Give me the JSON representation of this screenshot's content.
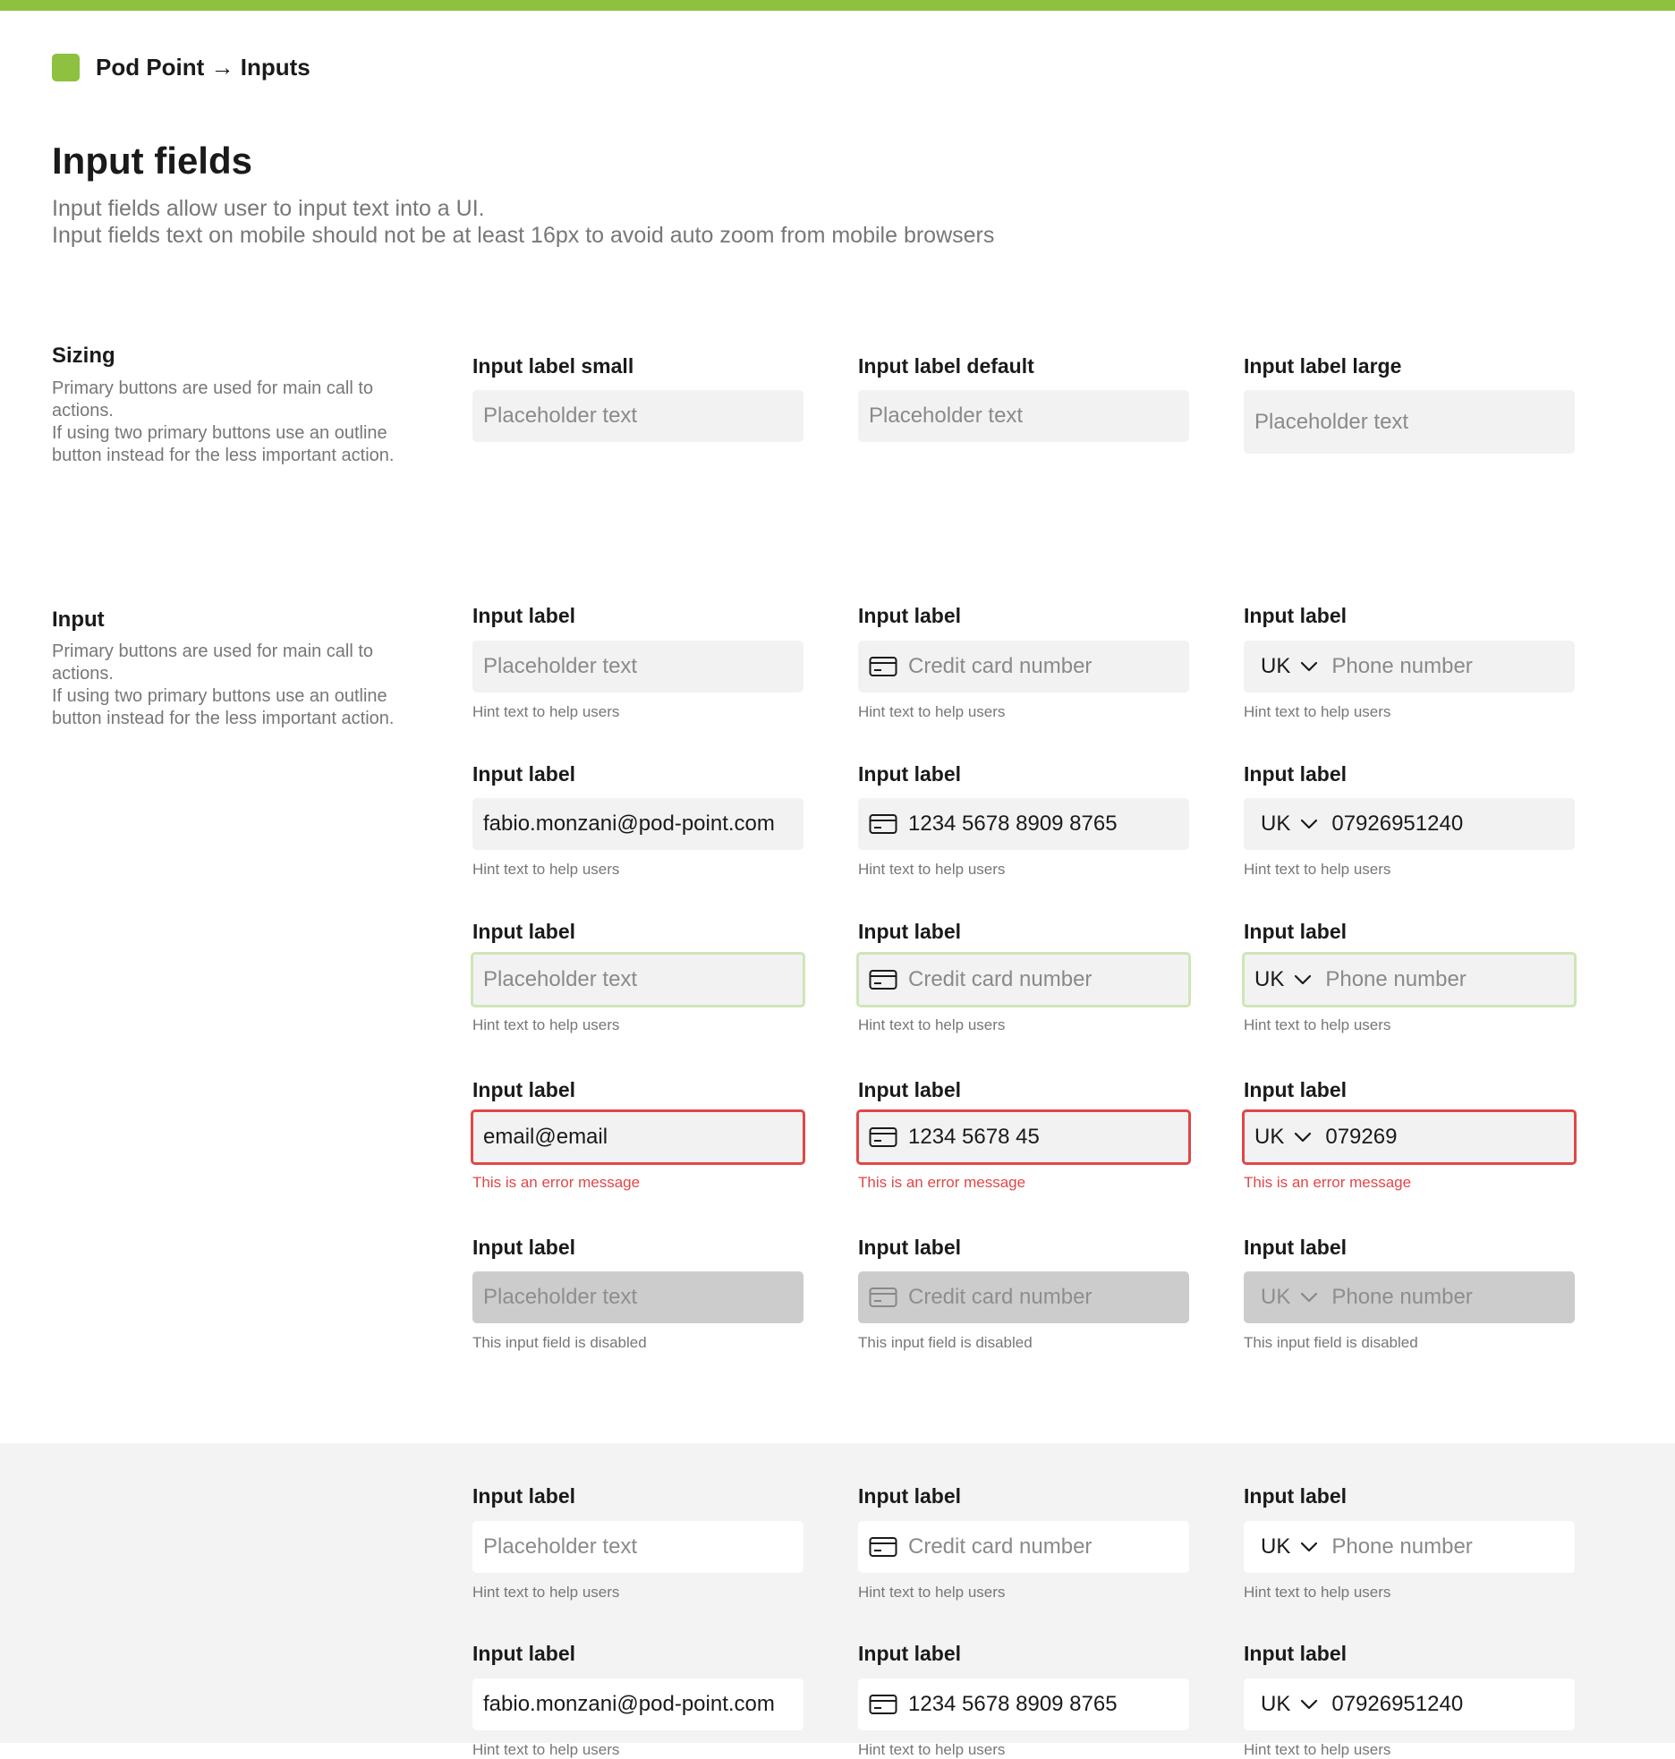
{
  "breadcrumb": "Pod Point → Inputs",
  "title": "Input fields",
  "description": [
    "Input fields allow user to input text into a UI.",
    "Input fields text on mobile should not be at least 16px to avoid auto zoom from mobile browsers"
  ],
  "sizing": {
    "title": "Sizing",
    "description": "Primary buttons are used for main call to actions.\nIf using two primary buttons use an outline button instead for the less important action.",
    "small": {
      "label": "Input label small",
      "placeholder": "Placeholder text"
    },
    "default": {
      "label": "Input label default",
      "placeholder": "Placeholder text"
    },
    "large": {
      "label": "Input label large",
      "placeholder": "Placeholder text"
    }
  },
  "input_section": {
    "title": "Input",
    "description": "Primary buttons are used for main call to actions.\nIf using two primary buttons use an outline button instead for the less important action."
  },
  "common": {
    "label": "Input label",
    "hint": "Hint text to help users",
    "error": "This is an error message",
    "disabled_hint": "This input field is disabled",
    "placeholder": "Placeholder text",
    "card_placeholder": "Credit card number",
    "phone_placeholder": "Phone number",
    "country": "UK"
  },
  "values": {
    "email": "fabio.monzani@pod-point.com",
    "card": "1234 5678 8909 8765",
    "phone": "07926951240",
    "email_error": "email@email",
    "card_error": "1234 5678 45",
    "phone_error": "079269"
  },
  "colors": {
    "brand": "#8dc13f",
    "error": "#e04747",
    "focus_border": "#cfe6b6",
    "field_bg": "#f2f2f2",
    "disabled_bg": "#cccccc"
  }
}
